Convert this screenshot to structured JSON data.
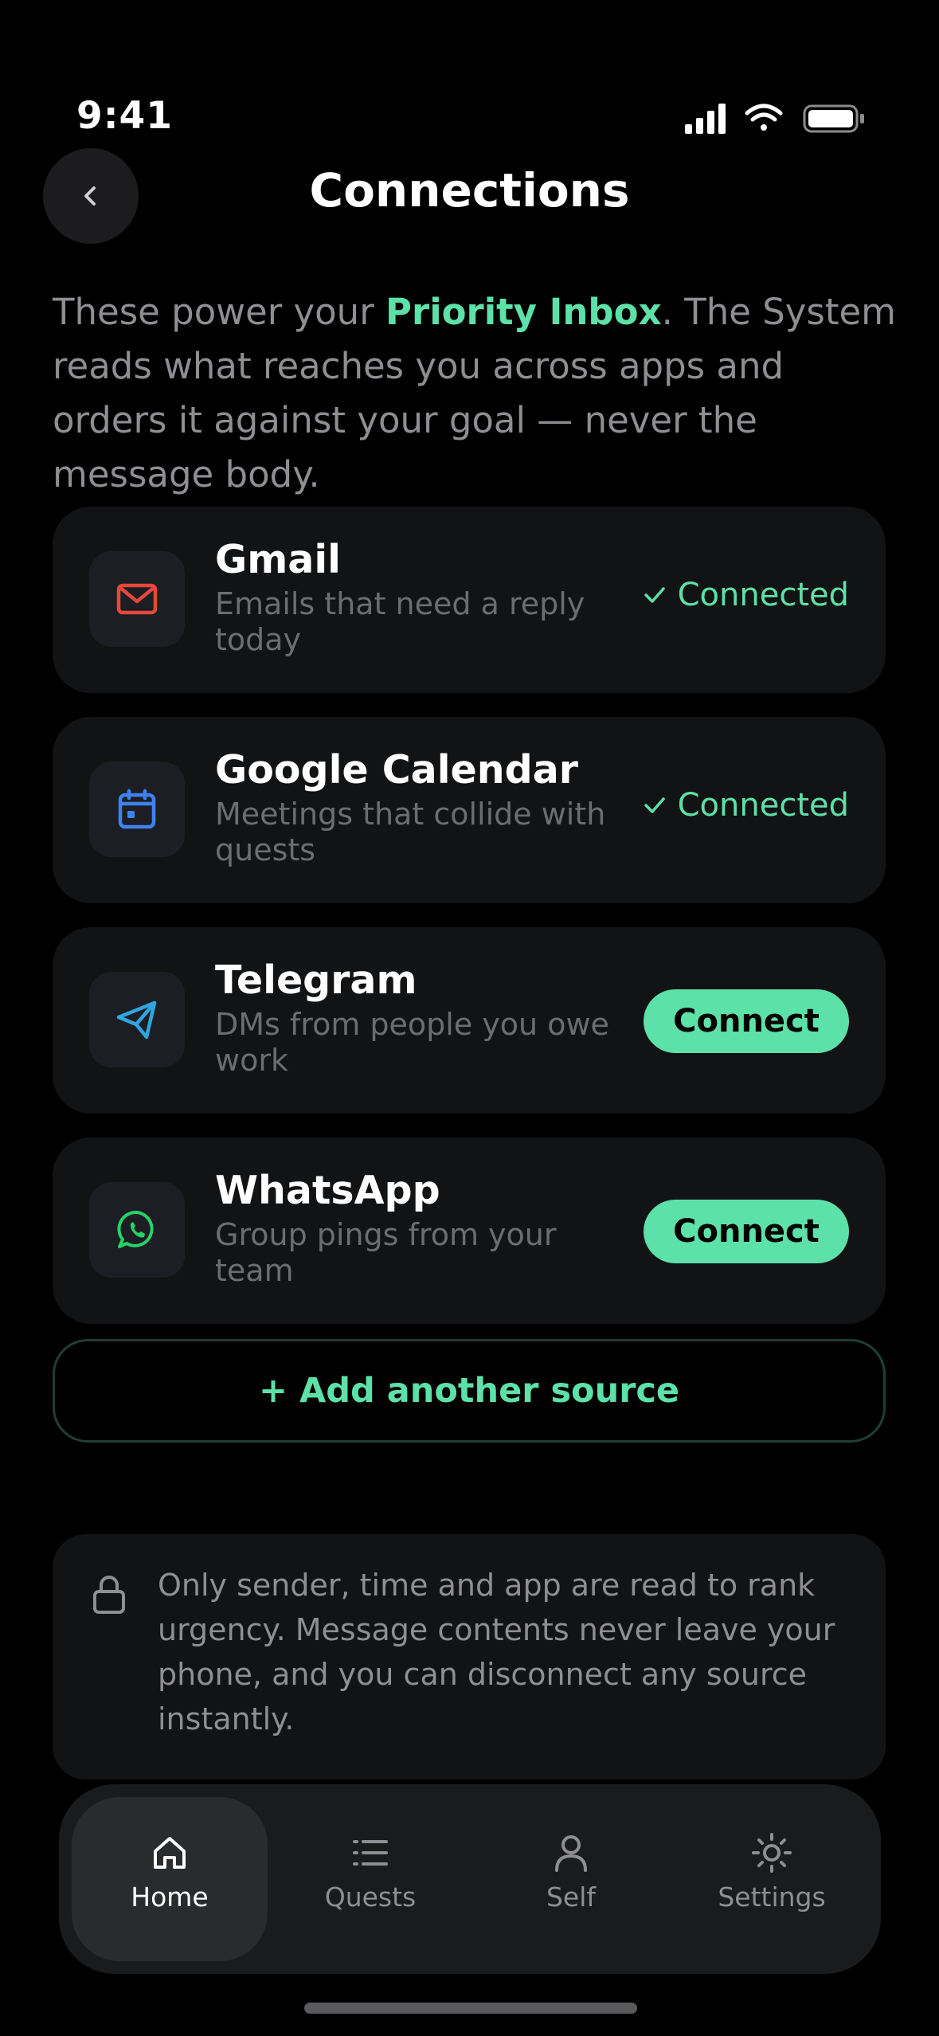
{
  "status_bar": {
    "time": "9:41"
  },
  "header": {
    "title": "Connections"
  },
  "intro": {
    "prefix": "These power your ",
    "highlight": "Priority Inbox",
    "suffix": ". The System reads what reaches you across apps and orders it against your goal — never the message body."
  },
  "connections": [
    {
      "name": "Gmail",
      "description": "Emails that need a reply today",
      "status": "Connected",
      "icon": "mail-icon",
      "icon_color": "#e5483b"
    },
    {
      "name": "Google Calendar",
      "description": "Meetings that collide with quests",
      "status": "Connected",
      "icon": "calendar-icon",
      "icon_color": "#3e82f0"
    },
    {
      "name": "Telegram",
      "description": "DMs from people you owe work",
      "action": "Connect",
      "icon": "telegram-icon",
      "icon_color": "#2ea6e0"
    },
    {
      "name": "WhatsApp",
      "description": "Group pings from your team",
      "action": "Connect",
      "icon": "whatsapp-icon",
      "icon_color": "#25d366"
    }
  ],
  "add_source": {
    "label": "+ Add another source"
  },
  "privacy": {
    "text": "Only sender, time and app are read to rank urgency. Message contents never leave your phone, and you can disconnect any source instantly."
  },
  "tabs": [
    {
      "label": "Home",
      "icon": "home-icon",
      "active": true
    },
    {
      "label": "Quests",
      "icon": "list-icon",
      "active": false
    },
    {
      "label": "Self",
      "icon": "person-icon",
      "active": false
    },
    {
      "label": "Settings",
      "icon": "sun-gear-icon",
      "active": false
    }
  ],
  "colors": {
    "accent": "#5ce1a8",
    "card": "#121314",
    "background": "#000000"
  }
}
